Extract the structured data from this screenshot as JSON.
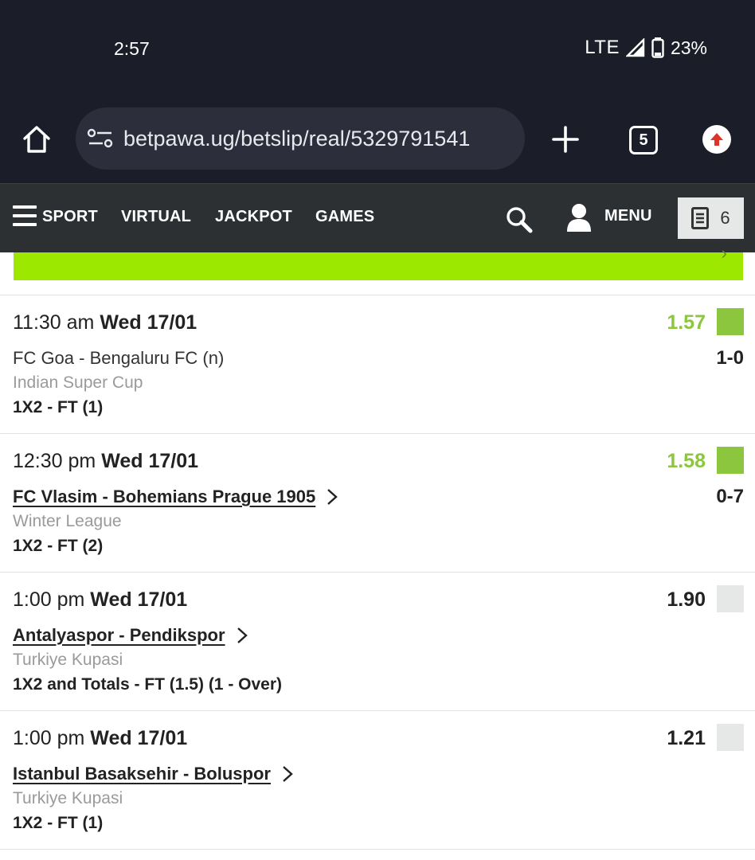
{
  "status_bar": {
    "time": "2:57",
    "network": "LTE",
    "battery": "23%"
  },
  "browser": {
    "url": "betpawa.ug/betslip/real/5329791541",
    "tab_count": "5"
  },
  "nav": {
    "items": [
      "SPORT",
      "VIRTUAL",
      "JACKPOT",
      "GAMES"
    ],
    "menu_label": "MENU",
    "betslip_count": "6"
  },
  "colors": {
    "won": "#8cc63f",
    "pending": "#e6e7e7",
    "banner": "#9ce800",
    "nav_bg": "#2d3033"
  },
  "bets": [
    {
      "time": "11:30 am",
      "date": "Wed 17/01",
      "odds": "1.57",
      "status": "won",
      "match": "FC Goa - Bengaluru FC (n)",
      "linked": false,
      "score": "1-0",
      "league": "Indian Super Cup",
      "market": "1X2 - FT (1)"
    },
    {
      "time": "12:30 pm",
      "date": "Wed 17/01",
      "odds": "1.58",
      "status": "won",
      "match": "FC Vlasim - Bohemians Prague 1905",
      "linked": true,
      "score": "0-7",
      "league": "Winter League",
      "market": "1X2 - FT (2)"
    },
    {
      "time": "1:00 pm",
      "date": "Wed 17/01",
      "odds": "1.90",
      "status": "pending",
      "match": "Antalyaspor - Pendikspor",
      "linked": true,
      "score": "",
      "league": "Turkiye Kupasi",
      "market": "1X2 and Totals - FT (1.5) (1 - Over)"
    },
    {
      "time": "1:00 pm",
      "date": "Wed 17/01",
      "odds": "1.21",
      "status": "pending",
      "match": "Istanbul Basaksehir - Boluspor",
      "linked": true,
      "score": "",
      "league": "Turkiye Kupasi",
      "market": "1X2 - FT (1)"
    }
  ]
}
